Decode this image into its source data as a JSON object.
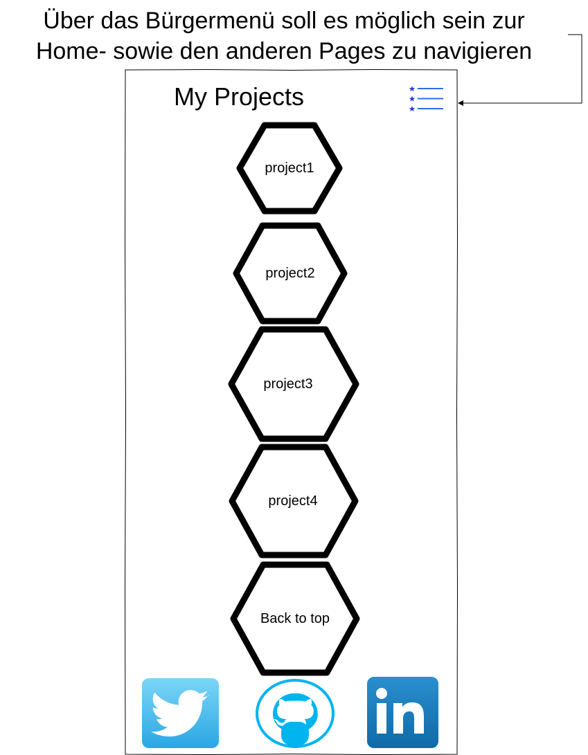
{
  "annotation": {
    "line1": "Über das Bürgermenü soll es möglich sein zur",
    "line2": "Home- sowie den anderen Pages zu navigieren"
  },
  "page": {
    "title": "My Projects"
  },
  "menu": {
    "icon": "burger-menu-icon",
    "color": "#3b5bdb"
  },
  "hexagons": [
    {
      "label": "project1"
    },
    {
      "label": "project2"
    },
    {
      "label": "project3"
    },
    {
      "label": "project4"
    },
    {
      "label": "Back to top"
    }
  ],
  "social": [
    {
      "name": "twitter",
      "icon": "twitter-icon",
      "color": "#4ec2f0"
    },
    {
      "name": "github",
      "icon": "github-icon",
      "color": "#00b4ef"
    },
    {
      "name": "linkedin",
      "icon": "linkedin-icon",
      "color": "#1177b5"
    }
  ]
}
